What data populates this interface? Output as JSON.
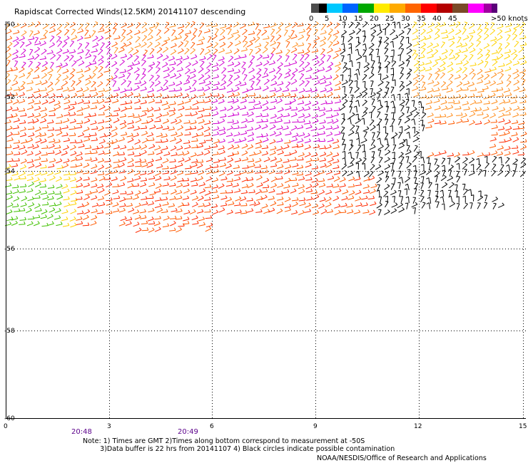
{
  "title": "Rapidscat Corrected Winds(12.5KM) 20141107 descending",
  "legend": {
    "swatches": [
      {
        "color": "#4d4d4d"
      },
      {
        "color": "#000000"
      },
      {
        "color": "#00c8ff"
      },
      {
        "color": "#0064ff"
      },
      {
        "color": "#00a800"
      },
      {
        "color": "#ffeb00"
      },
      {
        "color": "#ffaa00"
      },
      {
        "color": "#ff6400"
      },
      {
        "color": "#ff0000"
      },
      {
        "color": "#b40000"
      },
      {
        "color": "#7a4a28"
      },
      {
        "color": "#ff00ff"
      },
      {
        "color": "#a000a0"
      },
      {
        "color": "#5a0078"
      }
    ],
    "labels": [
      "0",
      "5",
      "10",
      "15",
      "20",
      "25",
      "30",
      "35",
      "40",
      "45",
      ">50 knots"
    ]
  },
  "map": {
    "lon_ticks": [
      "0",
      "3",
      "6",
      "9",
      "12",
      "15"
    ],
    "lat_ticks": [
      "-50",
      "-52",
      "-54",
      "-56",
      "-58",
      "-60"
    ],
    "times": [
      "20:48",
      "20:49"
    ],
    "lon_range": [
      0,
      15
    ],
    "lat_range": [
      -60,
      -50
    ],
    "grid": true,
    "gridline_style": "dotted"
  },
  "wind_fields": [
    {
      "region": "north-west band",
      "speed_knots": "25-40",
      "color": "#ff8c1a"
    },
    {
      "region": "central band",
      "speed_knots": "30-45",
      "color": "#ff2a00"
    },
    {
      "region": "magenta patches",
      "speed_knots": "45-50",
      "color": "#d000d0"
    },
    {
      "region": "west edge -54.5",
      "speed_knots": "15-20",
      "color": "#40c000"
    },
    {
      "region": "contaminated east",
      "speed_knots": "flagged",
      "color": "#000000"
    },
    {
      "region": "north-east",
      "speed_knots": "20-25",
      "color": "#ffd200"
    }
  ],
  "notes": {
    "line1": "Note: 1) Times are GMT 2)Times along bottom correspond to measurement at -50S",
    "line2": "3)Data buffer is 22 hrs from 20141107 4) Black circles indicate possible contamination",
    "credit": "NOAA/NESDIS/Office of Research and Applications"
  }
}
